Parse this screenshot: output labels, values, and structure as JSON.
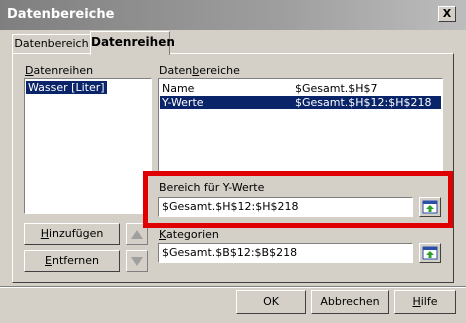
{
  "window": {
    "title": "Datenbereiche",
    "close_glyph": "X"
  },
  "tabs": [
    {
      "label": "Datenbereich",
      "active": false
    },
    {
      "label": "Datenreihen",
      "active": true
    }
  ],
  "series_panel": {
    "label_hotkey": "D",
    "label_rest": "atenreihen",
    "items": [
      "Wasser [Liter]"
    ]
  },
  "ranges_panel": {
    "label_prefix": "Daten",
    "label_hotkey": "b",
    "label_rest": "ereiche",
    "rows": [
      {
        "name": "Name",
        "range": "$Gesamt.$H$7",
        "selected": false
      },
      {
        "name": "Y-Werte",
        "range": "$Gesamt.$H$12:$H$218",
        "selected": true
      }
    ]
  },
  "y_range": {
    "label": "Bereich für Y-Werte",
    "value": "$Gesamt.$H$12:$H$218"
  },
  "categories": {
    "label_hotkey": "K",
    "label_rest": "ategorien",
    "value": "$Gesamt.$B$12:$B$218"
  },
  "buttons": {
    "add_hotkey": "H",
    "add_rest": "inzufügen",
    "remove_hotkey": "E",
    "remove_rest": "ntfernen",
    "ok": "OK",
    "cancel": "Abbrechen",
    "help_hotkey": "H",
    "help_rest": "ilfe"
  },
  "colors": {
    "highlight_frame": "#e00000",
    "selection": "#0a246a",
    "dialog_bg": "#d4d0c8"
  },
  "icons": {
    "move_up": "triangle-up-icon",
    "move_down": "triangle-down-icon",
    "shrink": "shrink-dialog-icon"
  }
}
